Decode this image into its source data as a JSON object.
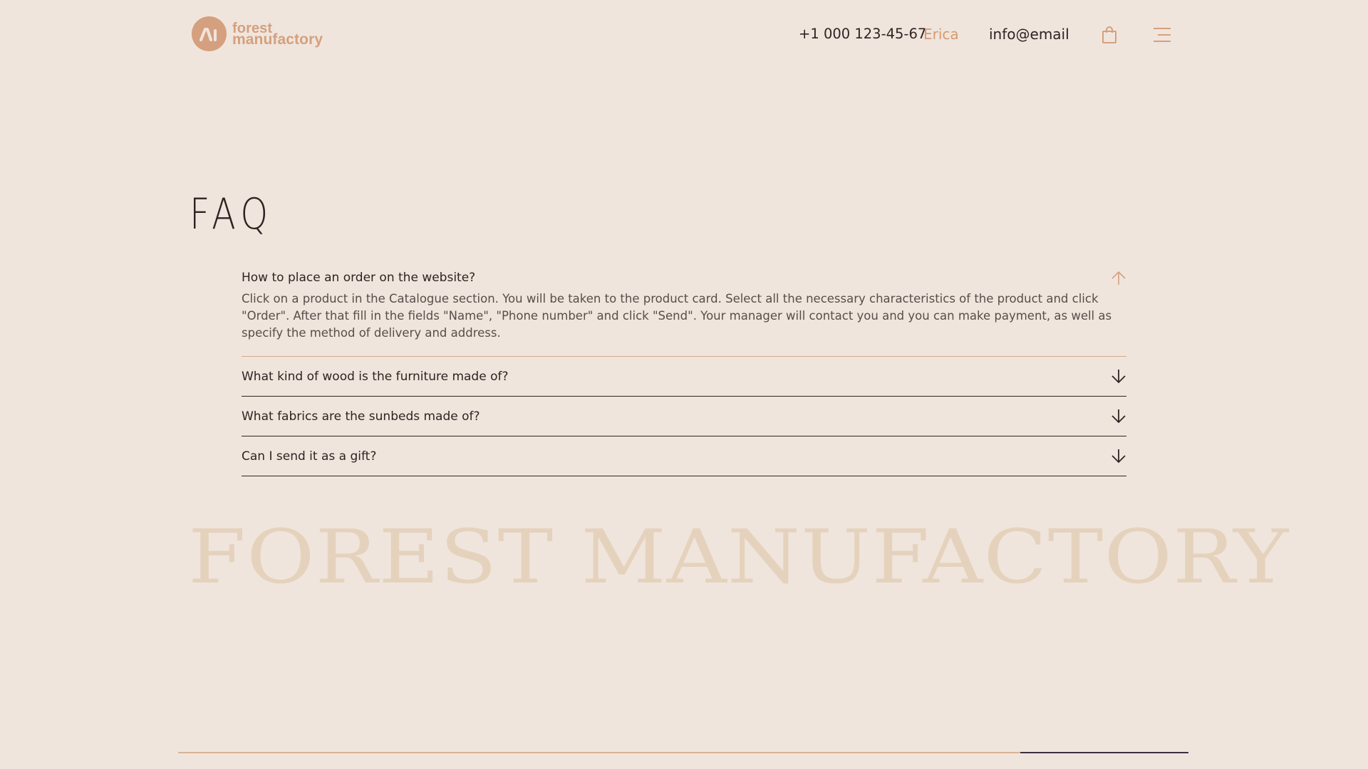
{
  "header": {
    "logo": {
      "mark_text": "ʌı",
      "line1": "forest",
      "line2": "manufactory"
    },
    "phone": "+1 000 123-45-67",
    "messenger": "Erica",
    "email": "info@email",
    "icons": {
      "cart": "shopping-bag-icon",
      "menu": "hamburger-menu-icon"
    }
  },
  "faq": {
    "title": "FAQ",
    "items": [
      {
        "question": "How to place an order on the website?",
        "answer": "Click on a product in the Catalogue section. You will be taken to the product card. Select all the necessary characteristics of the product and click \"Order\". After that fill in the fields \"Name\", \"Phone number\" and click \"Send\". Your manager will contact you and you can make payment, as well as specify the method of delivery and address.",
        "expanded": true
      },
      {
        "question": "What kind of wood is the furniture made of?",
        "expanded": false
      },
      {
        "question": "What fabrics are the sunbeds made of?",
        "expanded": false
      },
      {
        "question": "Can I send it as a gift?",
        "expanded": false
      }
    ]
  },
  "brand_watermark": "FOREST MANUFACTORY",
  "scroll_progress": 0.833,
  "colors": {
    "background": "#f0e5dc",
    "accent": "#d4a07f",
    "text": "#2f2323",
    "watermark": "#e5d2bd"
  }
}
